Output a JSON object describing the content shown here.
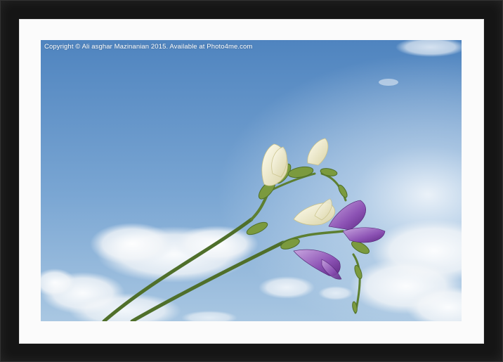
{
  "photo": {
    "caption": "Copyright © Ali asghar Mazinanian 2015. Available at Photo4me.com",
    "subject": "freesia flowers against blue sky with clouds",
    "colors": {
      "frame": "#151515",
      "mount": "#fbfbfb",
      "sky_top": "#4f84bf",
      "sky_bottom": "#a9c7e2",
      "stem": "#4f6f2a",
      "petal_white": "#f4f1dc",
      "petal_purple": "#8c52b4"
    }
  }
}
